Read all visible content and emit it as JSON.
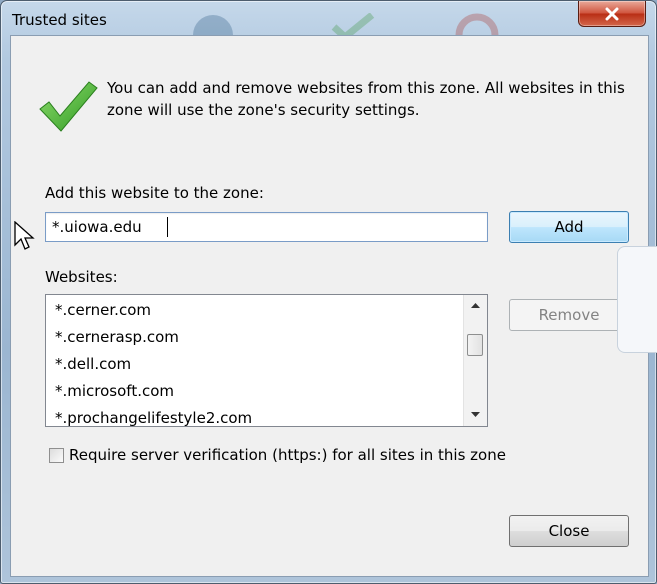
{
  "window": {
    "title": "Trusted sites",
    "close_icon": "close-x-icon"
  },
  "header": {
    "icon": "green-checkmark-icon",
    "description": "You can add and remove websites from this zone. All websites in this zone will use the zone's security settings."
  },
  "add_website": {
    "label": "Add this website to the zone:",
    "value": "*.uiowa.edu",
    "button_label": "Add"
  },
  "websites": {
    "label": "Websites:",
    "items": [
      "*.cerner.com",
      "*.cernerasp.com",
      "*.dell.com",
      "*.microsoft.com",
      "*.prochangelifestyle2.com"
    ],
    "remove_label": "Remove"
  },
  "require_verification": {
    "label": "Require server verification (https:) for all sites in this zone",
    "checked": false
  },
  "footer": {
    "close_label": "Close"
  },
  "colors": {
    "default_button": "#a7d9f5",
    "close_button": "#c93c20",
    "checkmark": "#3fae2a"
  }
}
